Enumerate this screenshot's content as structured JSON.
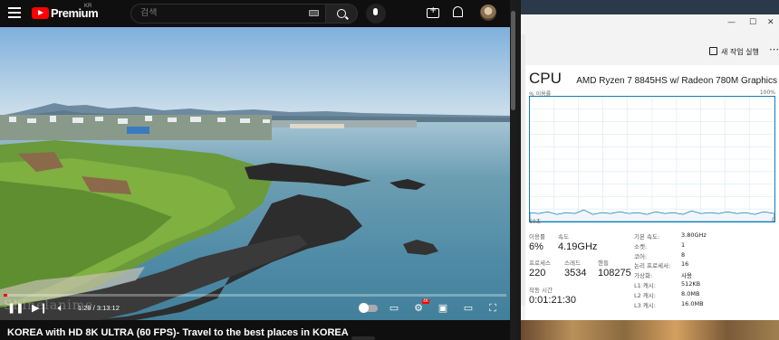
{
  "youtube": {
    "brand": "Premium",
    "region": "KR",
    "search_placeholder": "검색",
    "video_title": "KOREA with HD 8K ULTRA (60 FPS)- Travel to the best places in KOREA",
    "time_display": "1:28 / 3:13:12",
    "progress_fraction": 0.008,
    "watermark": "Shinelanime",
    "hd_badge": "4K"
  },
  "taskmanager": {
    "new_task_label": "새 작업 실행",
    "cpu_heading": "CPU",
    "cpu_model": "AMD Ryzen 7 8845HS w/ Radeon 780M Graphics",
    "graph_label_left": "% 이용률",
    "graph_label_right": "100%",
    "graph_bottom_left": "60초",
    "graph_bottom_right": "0",
    "stats": {
      "utilization_label": "이용률",
      "utilization_value": "6%",
      "speed_label": "속도",
      "speed_value": "4.19GHz",
      "processes_label": "프로세스",
      "processes_value": "220",
      "threads_label": "스레드",
      "threads_value": "3534",
      "handles_label": "핸들",
      "handles_value": "108275",
      "uptime_label": "작동 시간",
      "uptime_value": "0:01:21:30"
    },
    "details": [
      {
        "key": "기본 속도:",
        "value": "3.80GHz"
      },
      {
        "key": "소켓:",
        "value": "1"
      },
      {
        "key": "코어:",
        "value": "8"
      },
      {
        "key": "논리 프로세서:",
        "value": "16"
      },
      {
        "key": "가상화:",
        "value": "사용"
      },
      {
        "key": "L1 캐시:",
        "value": "512KB"
      },
      {
        "key": "L2 캐시:",
        "value": "8.0MB"
      },
      {
        "key": "L3 캐시:",
        "value": "16.0MB"
      }
    ]
  }
}
